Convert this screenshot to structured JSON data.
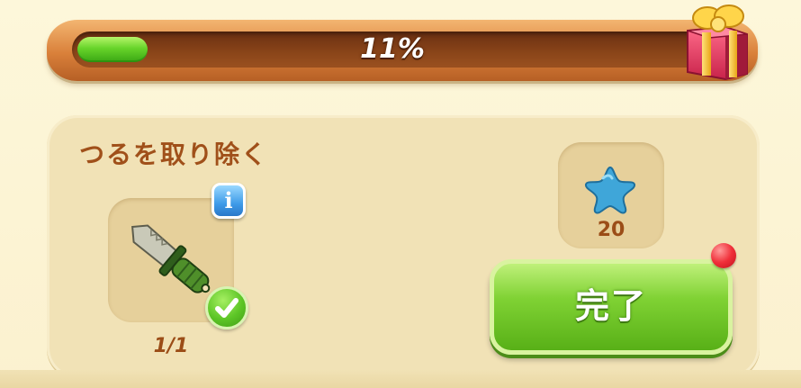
{
  "progress": {
    "percent": 11,
    "label": "11%"
  },
  "task": {
    "title": "つるを取り除く",
    "tool": {
      "icon": "knife-icon",
      "count": "1/1",
      "complete": true
    },
    "reward": {
      "icon": "blue-star-icon",
      "amount": "20"
    },
    "complete_button_label": "完了",
    "notification": true
  },
  "colors": {
    "progress_fill": "#67d42a",
    "title_text": "#a0501a",
    "button_green": "#80d234",
    "notify_red": "#f0303a"
  }
}
